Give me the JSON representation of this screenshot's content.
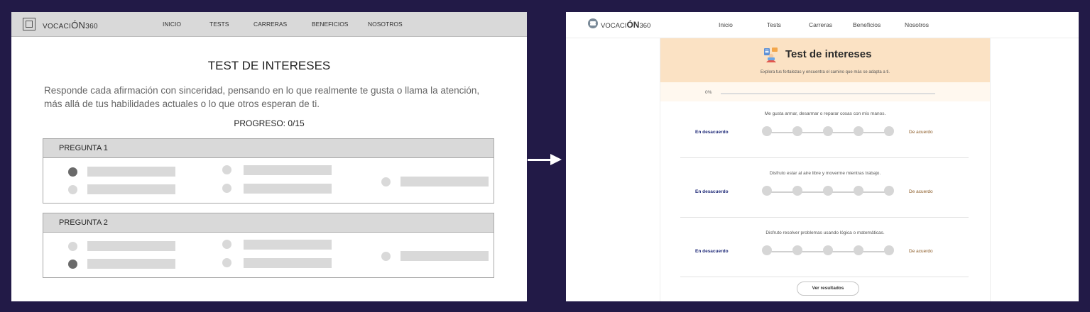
{
  "wireframe": {
    "logo_prefix": "VOCACI",
    "logo_big": "ÓN",
    "logo_suffix": "360",
    "nav": [
      "INICIO",
      "TESTS",
      "CARRERAS",
      "BENEFICIOS",
      "NOSOTROS"
    ],
    "title": "TEST DE INTERESES",
    "description": "Responde cada afirmación con sinceridad, pensando en lo que realmente te gusta o llama la atención, más allá de tus habilidades actuales o lo que otros esperan de ti.",
    "progress": "PROGRESO: 0/15",
    "questions": [
      {
        "label": "PREGUNTA 1",
        "selected": 0
      },
      {
        "label": "PREGUNTA 2",
        "selected": 1
      }
    ]
  },
  "final": {
    "logo_prefix": "VOCACI",
    "logo_big": "ÓN",
    "logo_suffix": "360",
    "nav": [
      "Inicio",
      "Tests",
      "Carreras",
      "Beneficios",
      "Nosotros"
    ],
    "hero_icon": "test-illustration-icon",
    "title": "Test de intereses",
    "subtitle": "Explora tus fortalezas y encuentra el camino que más se adapta a ti.",
    "progress_label": "0%",
    "progress_value": 0,
    "scale_left": "En desacuerdo",
    "scale_right": "De acuerdo",
    "questions": [
      "Me gusta armar, desarmar o reparar cosas con mis manos.",
      "Disfruto estar al aire libre y moverme mientras trabajo.",
      "Disfruto resolver problemas usando lógica o matemáticas."
    ],
    "button": "Ver resultados"
  },
  "colors": {
    "background": "#221a47",
    "hero": "#fbe2c4",
    "disagree_text": "#1f2a78",
    "agree_text": "#8a5a25",
    "wire_gray": "#d9d9d9"
  }
}
